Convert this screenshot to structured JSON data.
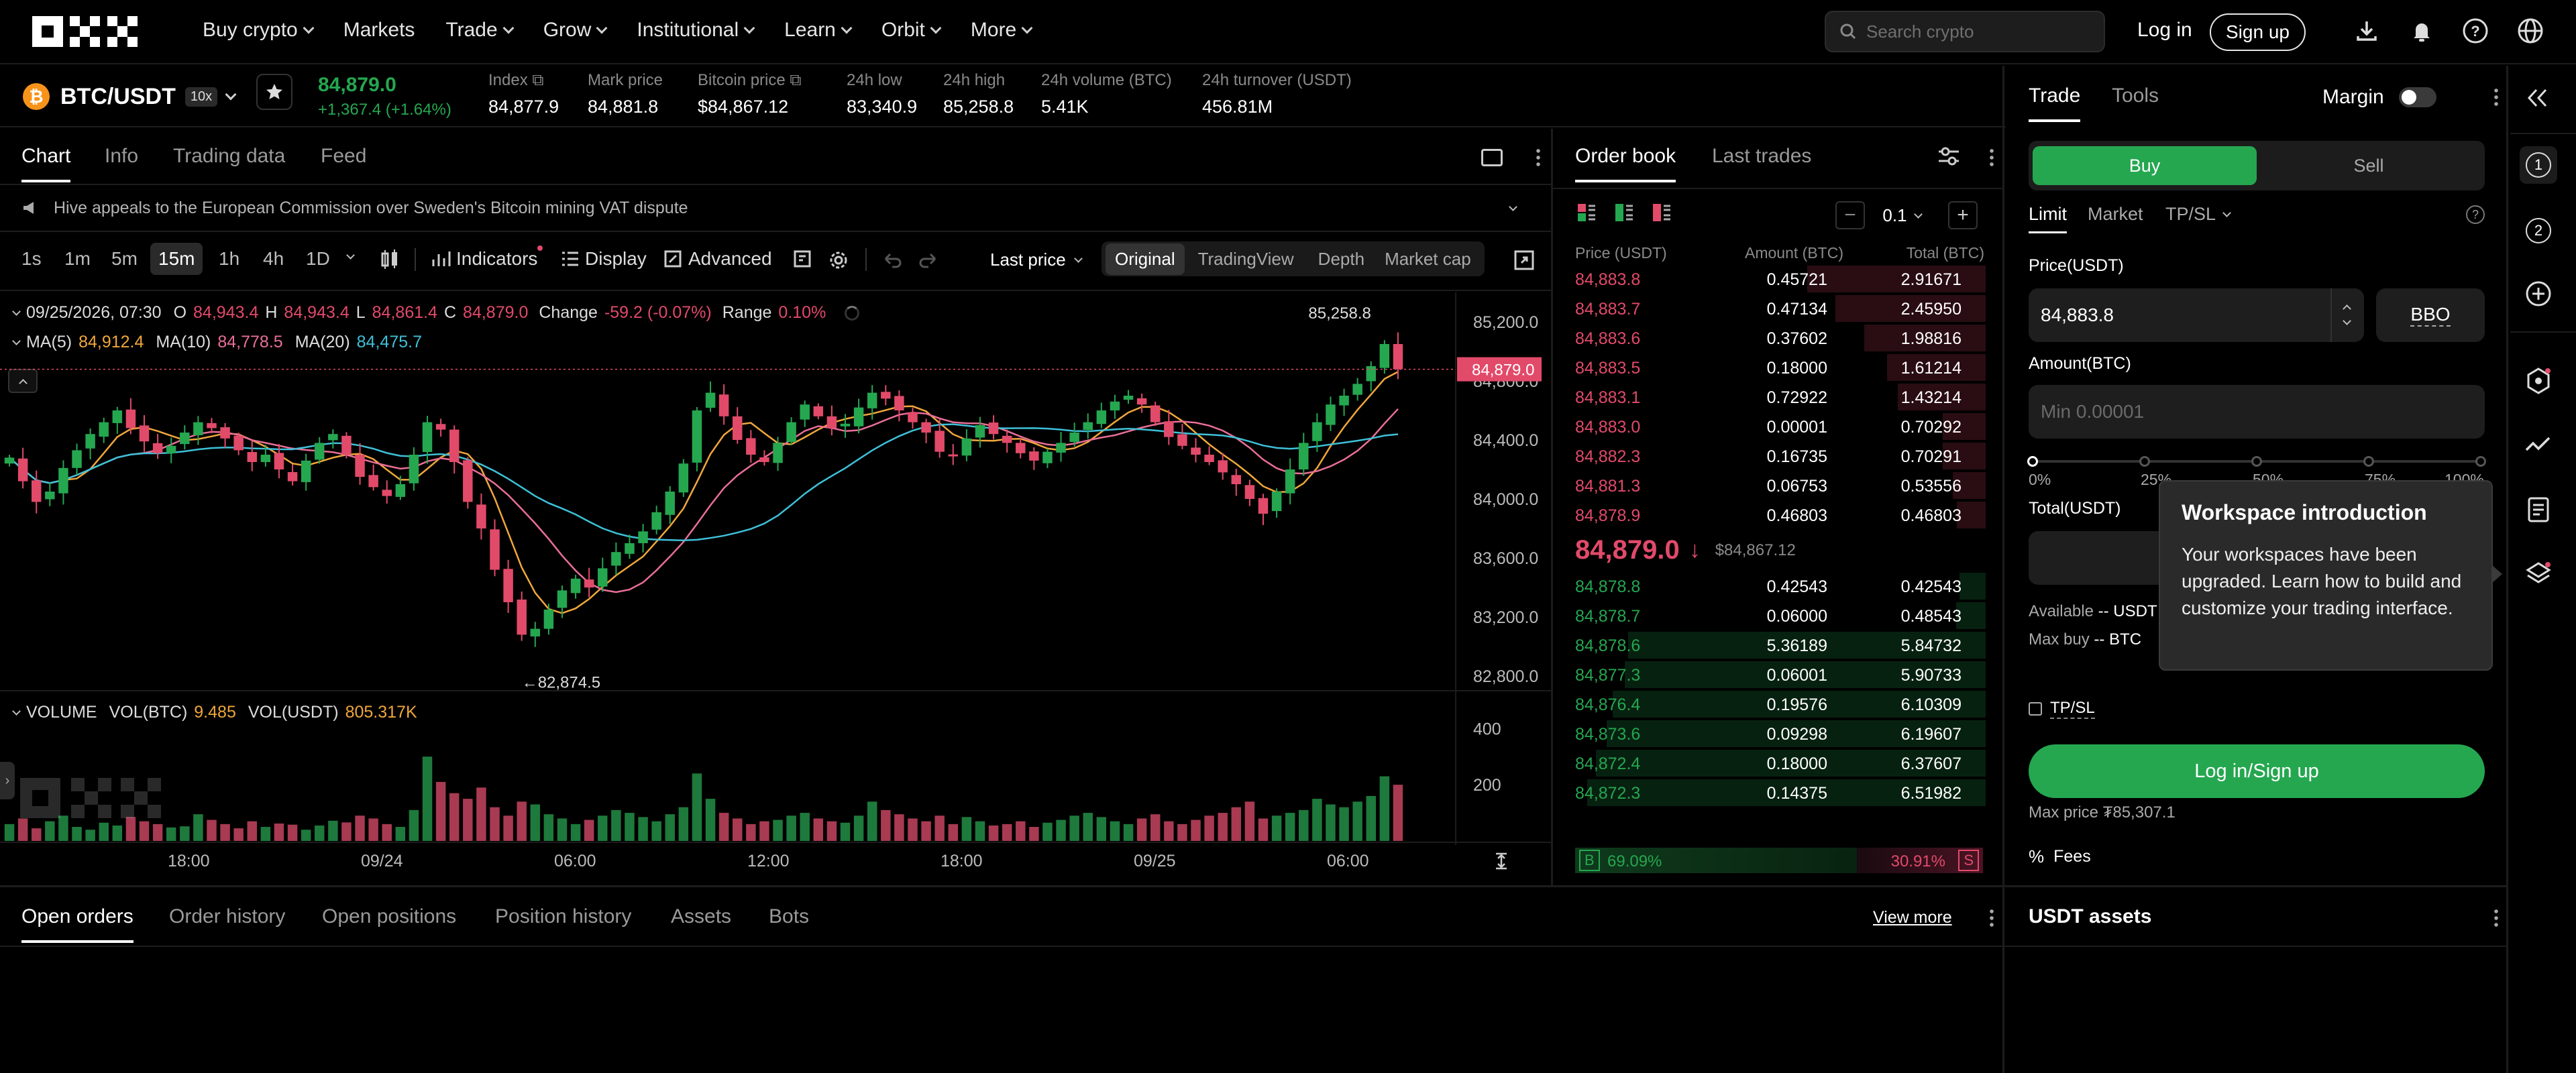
{
  "nav": {
    "items": [
      "Buy crypto",
      "Markets",
      "Trade",
      "Grow",
      "Institutional",
      "Learn",
      "Orbit",
      "More"
    ],
    "search_placeholder": "Search crypto",
    "login": "Log in",
    "signup": "Sign up"
  },
  "ticker": {
    "pair": "BTC/USDT",
    "leverage": "10x",
    "price": "84,879.0",
    "change": "+1,367.4 (+1.64%)",
    "stats": [
      {
        "label": "Index",
        "value": "84,877.9"
      },
      {
        "label": "Mark price",
        "value": "84,881.8"
      },
      {
        "label": "Bitcoin price",
        "value": "$84,867.12"
      },
      {
        "label": "24h low",
        "value": "83,340.9"
      },
      {
        "label": "24h high",
        "value": "85,258.8"
      },
      {
        "label": "24h volume (BTC)",
        "value": "5.41K"
      },
      {
        "label": "24h turnover (USDT)",
        "value": "456.81M"
      }
    ]
  },
  "chart_panel": {
    "tabs": [
      "Chart",
      "Info",
      "Trading data",
      "Feed"
    ],
    "news": "Hive appeals to the European Commission over Sweden's Bitcoin mining VAT dispute",
    "intervals": [
      "1s",
      "1m",
      "5m",
      "15m",
      "1h",
      "4h",
      "1D"
    ],
    "tools": {
      "indicators": "Indicators",
      "display": "Display",
      "advanced": "Advanced"
    },
    "price_type": "Last price",
    "views": [
      "Original",
      "TradingView",
      "Depth",
      "Market cap"
    ],
    "ohlc": {
      "time": "09/25/2026, 07:30",
      "o_label": "O",
      "o": "84,943.4",
      "h_label": "H",
      "h": "84,943.4",
      "l_label": "L",
      "l": "84,861.4",
      "c_label": "C",
      "c": "84,879.0",
      "change_label": "Change",
      "change": "-59.2 (-0.07%)",
      "range_label": "Range",
      "range": "0.10%"
    },
    "ma": {
      "ma5_label": "MA(5)",
      "ma5": "84,912.4",
      "ma10_label": "MA(10)",
      "ma10": "84,778.5",
      "ma20_label": "MA(20)",
      "ma20": "84,475.7"
    },
    "volume": {
      "label": "VOLUME",
      "btc_label": "VOL(BTC)",
      "btc": "9.485",
      "usdt_label": "VOL(USDT)",
      "usdt": "805.317K"
    },
    "hi_marker": "85,258.8",
    "lo_marker": "←82,874.5",
    "current_price_tag": "84,879.0"
  },
  "chart_data": {
    "type": "candlestick",
    "y_ticks": [
      "85,200.0",
      "84,800.0",
      "84,400.0",
      "84,000.0",
      "83,600.0",
      "83,200.0",
      "82,800.0"
    ],
    "ylim": [
      82700,
      85400
    ],
    "vol_ticks": [
      "400",
      "200"
    ],
    "x_ticks": [
      "18:00",
      "09/24",
      "06:00",
      "12:00",
      "18:00",
      "09/25",
      "06:00"
    ],
    "high": 85258.8,
    "low": 82874.5,
    "last": 84879.0,
    "closes": [
      84280,
      84120,
      83980,
      84050,
      84210,
      84330,
      84440,
      84520,
      84600,
      84480,
      84390,
      84310,
      84360,
      84450,
      84520,
      84480,
      84410,
      84330,
      84250,
      84300,
      84200,
      84120,
      84260,
      84380,
      84440,
      84300,
      84150,
      84080,
      84020,
      84100,
      84300,
      84520,
      84470,
      84250,
      83980,
      83800,
      83520,
      83300,
      83080,
      83120,
      83250,
      83380,
      83460,
      83400,
      83530,
      83640,
      83700,
      83780,
      83910,
      84050,
      84240,
      84600,
      84720,
      84560,
      84400,
      84300,
      84250,
      84380,
      84520,
      84640,
      84560,
      84480,
      84510,
      84620,
      84720,
      84680,
      84600,
      84520,
      84450,
      84320,
      84300,
      84410,
      84500,
      84440,
      84380,
      84310,
      84260,
      84320,
      84380,
      84450,
      84520,
      84600,
      84660,
      84700,
      84640,
      84520,
      84420,
      84360,
      84300,
      84250,
      84180,
      84100,
      84000,
      83900,
      84050,
      84200,
      84380,
      84520,
      84640,
      84700,
      84780,
      84900,
      85050,
      84879
    ],
    "volumes": [
      60,
      80,
      45,
      70,
      90,
      50,
      40,
      65,
      55,
      85,
      70,
      60,
      48,
      52,
      95,
      75,
      60,
      45,
      70,
      50,
      62,
      58,
      40,
      55,
      72,
      66,
      90,
      80,
      60,
      50,
      110,
      300,
      210,
      170,
      150,
      190,
      120,
      90,
      140,
      130,
      95,
      80,
      60,
      75,
      90,
      110,
      100,
      85,
      70,
      95,
      120,
      240,
      150,
      100,
      80,
      60,
      70,
      75,
      90,
      100,
      80,
      70,
      65,
      90,
      140,
      110,
      95,
      80,
      70,
      90,
      60,
      85,
      70,
      55,
      60,
      70,
      50,
      65,
      75,
      90,
      100,
      85,
      70,
      60,
      80,
      95,
      70,
      60,
      75,
      90,
      100,
      120,
      140,
      80,
      90,
      100,
      110,
      150,
      130,
      120,
      140,
      160,
      230,
      200
    ]
  },
  "orderbook": {
    "tabs": [
      "Order book",
      "Last trades"
    ],
    "precision": "0.1",
    "headers": [
      "Price (USDT)",
      "Amount (BTC)",
      "Total (BTC)"
    ],
    "asks": [
      [
        "84,883.8",
        "0.45721",
        "2.91671"
      ],
      [
        "84,883.7",
        "0.47134",
        "2.45950"
      ],
      [
        "84,883.6",
        "0.37602",
        "1.98816"
      ],
      [
        "84,883.5",
        "0.18000",
        "1.61214"
      ],
      [
        "84,883.1",
        "0.72922",
        "1.43214"
      ],
      [
        "84,883.0",
        "0.00001",
        "0.70292"
      ],
      [
        "84,882.3",
        "0.16735",
        "0.70291"
      ],
      [
        "84,881.3",
        "0.06753",
        "0.53556"
      ],
      [
        "84,878.9",
        "0.46803",
        "0.46803"
      ]
    ],
    "mid_price": "84,879.0",
    "mid_usd": "$84,867.12",
    "bids": [
      [
        "84,878.8",
        "0.42543",
        "0.42543"
      ],
      [
        "84,878.7",
        "0.06000",
        "0.48543"
      ],
      [
        "84,878.6",
        "5.36189",
        "5.84732"
      ],
      [
        "84,877.3",
        "0.06001",
        "5.90733"
      ],
      [
        "84,876.4",
        "0.19576",
        "6.10309"
      ],
      [
        "84,873.6",
        "0.09298",
        "6.19607"
      ],
      [
        "84,872.4",
        "0.18000",
        "6.37607"
      ],
      [
        "84,872.3",
        "0.14375",
        "6.51982"
      ]
    ],
    "buy_ratio_label": "B",
    "buy_ratio": "69.09%",
    "sell_ratio": "30.91%",
    "sell_ratio_label": "S"
  },
  "trade": {
    "tabs": [
      "Trade",
      "Tools"
    ],
    "margin_label": "Margin",
    "buy": "Buy",
    "sell": "Sell",
    "order_types": [
      "Limit",
      "Market",
      "TP/SL"
    ],
    "price_label": "Price(USDT)",
    "price_value": "84,883.8",
    "bbo": "BBO",
    "amount_label": "Amount(BTC)",
    "amount_placeholder": "Min 0.00001",
    "slider_marks": [
      "0%",
      "25%",
      "50%",
      "75%",
      "100%"
    ],
    "total_label": "Total(USDT)",
    "available_label": "Available",
    "available_value": "-- USDT",
    "maxbuy_label": "Max buy",
    "maxbuy_value": "-- BTC",
    "tpsl": "TP/SL",
    "login_btn": "Log in/Sign up",
    "max_price": "Max price ₮85,307.1",
    "fees": "Fees"
  },
  "tooltip": {
    "title": "Workspace introduction",
    "body": "Your workspaces have been upgraded. Learn how to build and customize your trading interface."
  },
  "sidebar": {
    "numbers": [
      "1",
      "2"
    ]
  },
  "bottom": {
    "tabs": [
      "Open orders",
      "Order history",
      "Open positions",
      "Position history",
      "Assets",
      "Bots"
    ],
    "view_more": "View more",
    "assets_title": "USDT assets"
  },
  "colors": {
    "green": "#25a750",
    "red": "#e24a6a",
    "bg": "#000000",
    "panel_border": "#1c1c1c"
  }
}
